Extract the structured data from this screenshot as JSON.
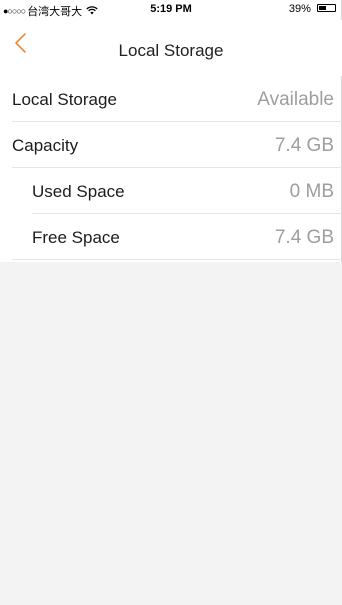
{
  "status_bar": {
    "signal": "●○○○○",
    "carrier": "台湾大哥大",
    "time": "5:19 PM",
    "battery_percent": "39%",
    "battery_level": 0.39,
    "wifi_icon": "wifi-icon",
    "battery_icon": "battery-icon"
  },
  "nav": {
    "back_icon": "chevron-left-icon",
    "title": "Local Storage",
    "accent_color": "#f08b3a"
  },
  "rows": [
    {
      "label": "Local Storage",
      "value": "Available"
    },
    {
      "label": "Capacity",
      "value": "7.4 GB"
    },
    {
      "label": "Used Space",
      "value": "0 MB"
    },
    {
      "label": "Free Space",
      "value": "7.4 GB"
    }
  ],
  "colors": {
    "value_text": "#9e9e9e",
    "background_empty": "#f3f3f3",
    "divider": "#e6e6e6"
  }
}
